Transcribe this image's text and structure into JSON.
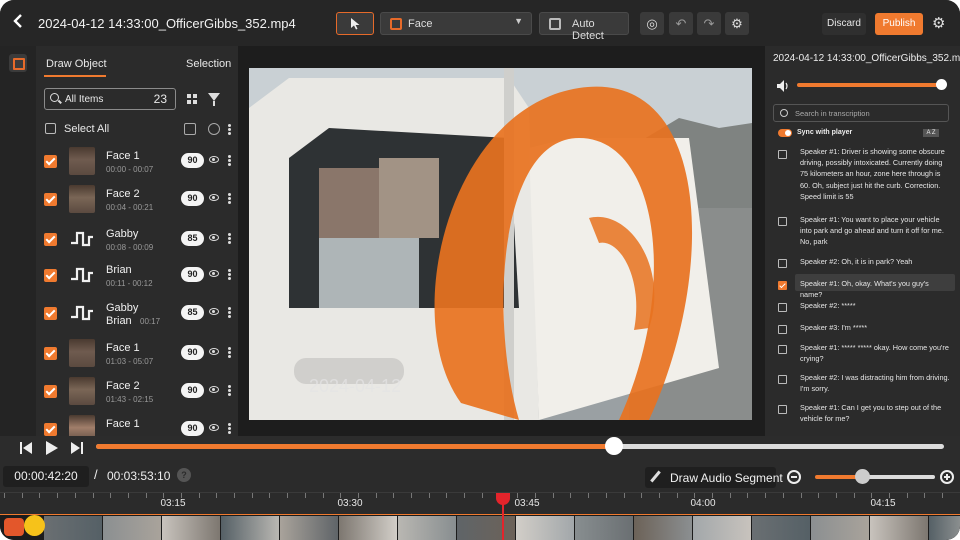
{
  "header": {
    "title": "2024-04-12 14:33:00_OfficerGibbs_352.mp4",
    "mode_select": "Face",
    "auto_detect": "Auto Detect",
    "discard": "Discard",
    "publish": "Publish"
  },
  "objects_panel": {
    "tab_draw": "Draw Object",
    "tab_selection": "Selection",
    "search_label": "All Items",
    "item_count": "23",
    "select_all": "Select All",
    "items": [
      {
        "name": "Face 1",
        "time": "00:00 - 00:07",
        "score": "90",
        "kind": "face"
      },
      {
        "name": "Face 2",
        "time": "00:04 - 00:21",
        "score": "90",
        "kind": "face"
      },
      {
        "name": "Gabby",
        "time": "00:08 - 00:09",
        "score": "85",
        "kind": "audio"
      },
      {
        "name": "Brian",
        "time": "00:11 - 00:12",
        "score": "90",
        "kind": "audio"
      },
      {
        "name": "Gabby",
        "name2": "Brian",
        "time": "00:17",
        "score": "85",
        "kind": "audio"
      },
      {
        "name": "Face 1",
        "time": "01:03 - 05:07",
        "score": "90",
        "kind": "face"
      },
      {
        "name": "Face 2",
        "time": "01:43 - 02:15",
        "score": "90",
        "kind": "face"
      },
      {
        "name": "Face 1",
        "time": "",
        "score": "90",
        "kind": "face"
      }
    ]
  },
  "video": {
    "timestamp_overlay": "2024-04-12"
  },
  "transcript": {
    "title": "2024-04-12 14:33:00_OfficerGibbs_352.mp4",
    "search_placeholder": "Search in transcription",
    "sync_label": "Sync with player",
    "sort_icon_text": "A Z",
    "segments": [
      {
        "text": "Speaker #1: Driver is showing some obscure driving, possibly intoxicated. Currently doing 75 kilometers an hour, zone here through is 60. Oh, subject just hit the curb. Correction. Speed limit is 55",
        "checked": false
      },
      {
        "text": "Speaker #1: You want to place your vehicle into park and go ahead and turn it off for me. No, park",
        "checked": false
      },
      {
        "text": "Speaker #2: Oh, it is in park? Yeah",
        "checked": false
      },
      {
        "text": "Speaker #1: Oh, okay. What's you guy's name?",
        "checked": true
      },
      {
        "text": "Speaker #2: *****",
        "checked": false
      },
      {
        "text": "Speaker #3: I'm *****",
        "checked": false
      },
      {
        "text": "Speaker #1: ***** ***** okay. How come you're crying?",
        "checked": false
      },
      {
        "text": "Speaker #2: I was distracting him from driving. I'm sorry.",
        "checked": false
      },
      {
        "text": "Speaker #1: Can I get you to step out of the vehicle for me?",
        "checked": false
      }
    ]
  },
  "player": {
    "progress": 0.611,
    "current_time": "00:00:42:20",
    "separator": "/",
    "duration": "00:03:53:10",
    "help": "?",
    "draw_audio": "Draw Audio Segment",
    "zoom_level": 0.39
  },
  "timeline": {
    "ticks": [
      "03:15",
      "03:30",
      "03:45",
      "04:00",
      "04:15"
    ]
  },
  "colors": {
    "accent": "#f07a2f",
    "playhead": "#e3242b",
    "background": "#2b2b2b"
  }
}
